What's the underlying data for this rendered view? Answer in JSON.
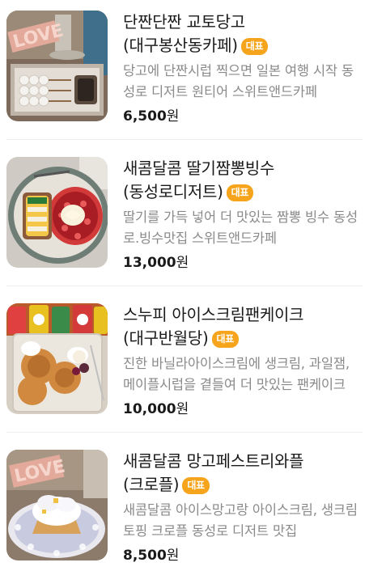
{
  "badge_label": "대표",
  "currency_suffix": "원",
  "colors": {
    "badge": "#f7a41d",
    "title": "#1a1a1a",
    "desc": "#8a8a8a",
    "divider": "#ededed"
  },
  "items": [
    {
      "title": "단짠단짠 교토당고 (대구봉산동카페)",
      "desc": "당고에 단짠시럽 찍으면 일본 여행 시작 동성로 디저트 원티어 스위트앤드카페",
      "price": "6,500",
      "image": "dango-skewers-tray"
    },
    {
      "title": "새콤달콤 딸기짬뽕빙수(동성로디저트)",
      "desc": "딸기를 가득 넣어 더 맛있는 짬뽕 빙수 동성로.빙수맛집 스위트앤드카페",
      "price": "13,000",
      "image": "strawberry-bingsu-bowl"
    },
    {
      "title": "스누피 아이스크림팬케이크(대구반월당)",
      "desc": "진한 바닐라아이스크림에 생크림, 과일잼, 메이플시럽을 곁들여 더 맛있는 팬케이크",
      "price": "10,000",
      "image": "snoopy-pancake-plate"
    },
    {
      "title": "새콤달콤 망고페스트리와플 (크로플)",
      "desc": "새콤달콤 아이스망고랑 아이스크림, 생크림 토핑 크로플 동성로 디저트 맛집",
      "price": "8,500",
      "image": "mango-croffle-plate"
    }
  ]
}
